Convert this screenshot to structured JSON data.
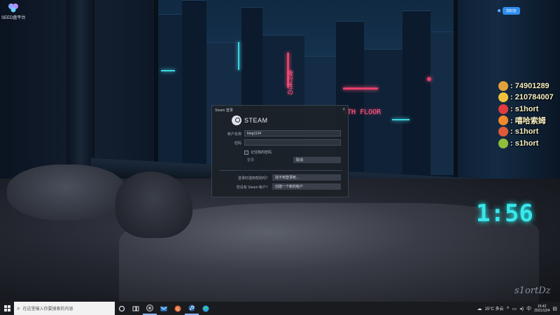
{
  "desktop": {
    "icon_label": "SEED盘平台"
  },
  "top_right_badge": {
    "label": "加好友"
  },
  "wallpaper": {
    "neon_sign_vertical": "夜行性の",
    "neon_sign_floor": "5TH FLOOR",
    "neon_clock": "1:56",
    "signature": "s1ortDz"
  },
  "chat_overlay": {
    "messages": [
      {
        "text": "74901289",
        "avatar_color": "#e2a13c"
      },
      {
        "text": "210784007",
        "avatar_color": "#f0c13a"
      },
      {
        "text": "s1hort",
        "avatar_color": "#e23b3b"
      },
      {
        "text": "嘻哈索姆",
        "avatar_color": "#f08a2a"
      },
      {
        "text": "s1hort",
        "avatar_color": "#e05a3a"
      },
      {
        "text": "s1hort",
        "avatar_color": "#8fbf3a"
      }
    ],
    "text_color": "#f8f2c4"
  },
  "steam_login": {
    "title": "Steam 登录",
    "close_glyph": "×",
    "logo_text": "STEAM",
    "account_label": "帐户名称",
    "account_value": "bing1134",
    "password_label": "密码",
    "password_value": "",
    "remember_label": "记住我的密码",
    "login_label": "登录",
    "cancel_label": "取消",
    "help_prompt": "登录时遇到帮助吗？",
    "help_button": "找不到登录帐...",
    "create_prompt": "您没有 Steam 帐户？",
    "create_button": "创建一个新的帐户"
  },
  "taskbar": {
    "search_placeholder": "在这里输入你要搜索的内容",
    "apps": [
      {
        "name": "cortana-icon",
        "color": "#d9dce2"
      },
      {
        "name": "task-view-icon",
        "color": "#d9dce2"
      },
      {
        "name": "obs-icon",
        "color": "#bfc3ca"
      },
      {
        "name": "mail-icon",
        "color": "#2f80d6"
      },
      {
        "name": "game-icon",
        "color": "#e06a2c"
      },
      {
        "name": "steam-icon",
        "color": "#2a6fb0"
      },
      {
        "name": "edge-icon",
        "color": "#2fa3e6"
      }
    ],
    "weather": "15°C 多云",
    "time": "15:42",
    "date": "2021/12/4"
  }
}
